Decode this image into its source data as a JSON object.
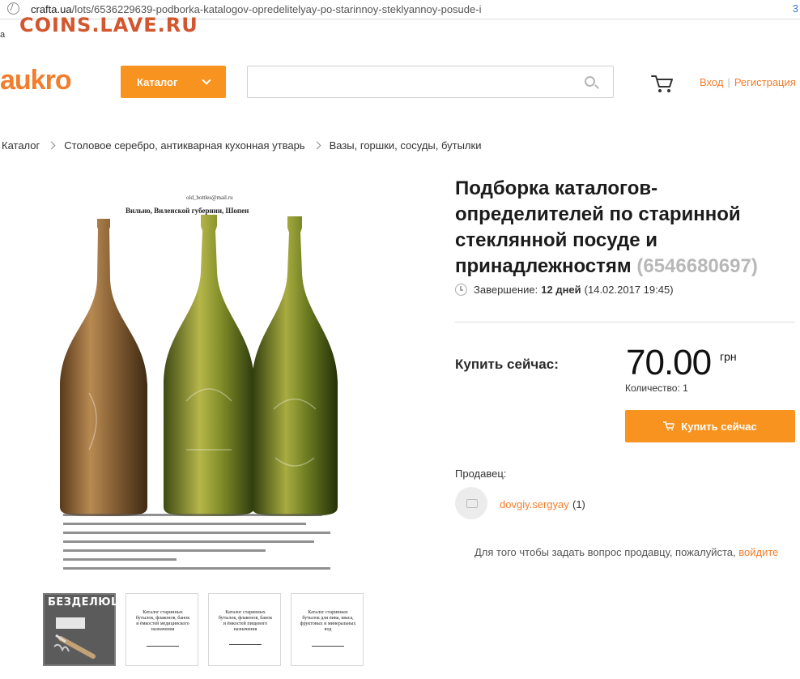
{
  "browser": {
    "url_host": "crafta.ua",
    "url_path": "/lots/6536229639-podborka-katalogov-opredelitelyay-po-starinnoy-steklyannoy-posude-i",
    "right_glyph": "3"
  },
  "watermark": "COINS.LAVE.RU",
  "left_fragment": "a",
  "header": {
    "logo": "aukro",
    "catalog_label": "Каталог",
    "search_placeholder": "",
    "login": "Вход",
    "separator": "|",
    "register": "Регистрация"
  },
  "breadcrumb": {
    "items": [
      "Каталог",
      "Столовое серебро, антикварная кухонная утварь",
      "Вазы, горшки, сосуды, бутылки"
    ]
  },
  "product": {
    "title": "Подборка каталогов-определителей по старинной стеклянной посуде и принадлежностям",
    "lot_id": "(6546680697)",
    "end_label": "Завершение:",
    "end_days": "12 дней",
    "end_date": "(14.02.2017 19:45)",
    "buy_now_label": "Купить сейчас:",
    "price": "70.00",
    "currency": "грн",
    "quantity": "Количество: 1",
    "buy_button": "Купить сейчас",
    "seller_label": "Продавец:",
    "seller_name": "dovgiy.sergyay",
    "seller_rating": "(1)",
    "ask_text": "Для того чтобы задать вопрос продавцу, пожалуйста,",
    "ask_login": "войдите"
  },
  "image": {
    "email": "old_bottles@mail.ru",
    "caption": "Вильно, Виленской губернии, Шопен"
  },
  "thumbnails": [
    {
      "title": "БЕЗДЕЛЮШКИ",
      "caption": ""
    },
    {
      "title": "",
      "caption": "Каталог старинных бутылок, флаконов, банок и ёмкостей медицинского назначения"
    },
    {
      "title": "",
      "caption": "Каталог старинных бутылок, флаконов, банок и ёмкостей пищевого назначения"
    },
    {
      "title": "",
      "caption": "Каталог старинных бутылок для пива, кваса, фруктовых и минеральных вод"
    }
  ],
  "colors": {
    "accent": "#f7931e",
    "link": "#f27d2c",
    "watermark": "#d2562e"
  }
}
